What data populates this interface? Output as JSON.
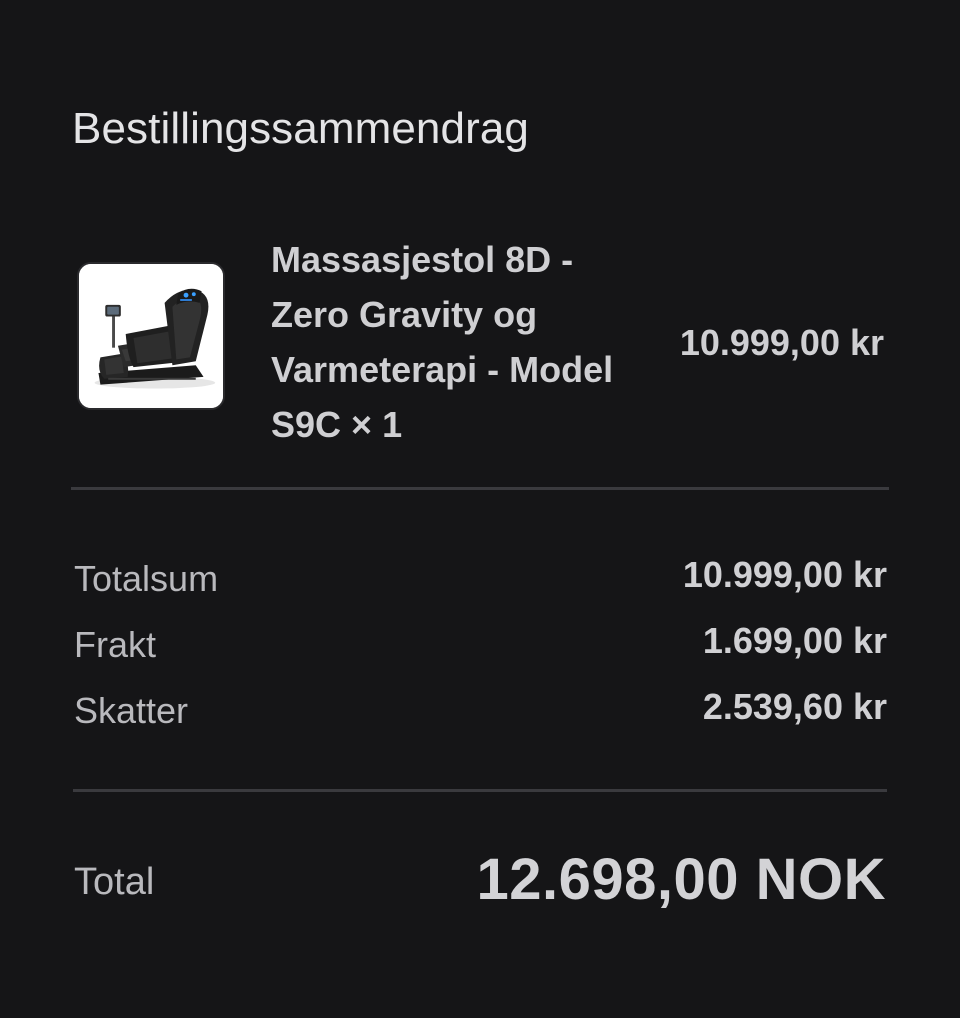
{
  "summary": {
    "title": "Bestillingssammendrag"
  },
  "item": {
    "image_icon": "massage-chair-image",
    "name": "Massasjestol 8D - Zero Gravity og Varmeterapi - Model S9C",
    "quantity_text": "× 1",
    "price": "10.999,00 kr"
  },
  "totals": {
    "subtotal_label": "Totalsum",
    "subtotal_value": "10.999,00 kr",
    "shipping_label": "Frakt",
    "shipping_value": "1.699,00 kr",
    "taxes_label": "Skatter",
    "taxes_value": "2.539,60 kr",
    "total_label": "Total",
    "total_value": "12.698,00 NOK"
  },
  "colors": {
    "background": "#151517",
    "divider": "#3a3a3e",
    "text": "#d0d0d3",
    "label": "#b9b9bd"
  }
}
